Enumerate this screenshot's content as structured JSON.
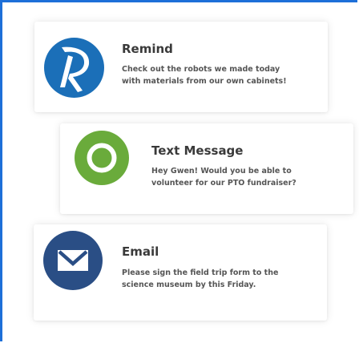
{
  "colors": {
    "frame": "#1d6fd8",
    "remind_blue": "#1b6fb8",
    "green": "#6aab3b",
    "navy": "#2a4e85"
  },
  "cards": {
    "remind": {
      "icon": "remind-logo-icon",
      "title": "Remind",
      "line1": "Check out the robots we made today",
      "line2": "with materials from our own cabinets!"
    },
    "text_message": {
      "icon": "chat-bubble-icon",
      "title": "Text Message",
      "line1": "Hey Gwen! Would you be able to",
      "line2": "volunteer for our PTO fundraiser?"
    },
    "email": {
      "icon": "envelope-icon",
      "title": "Email",
      "line1": "Please sign the field trip form to the",
      "line2": "science museum by this Friday."
    }
  }
}
